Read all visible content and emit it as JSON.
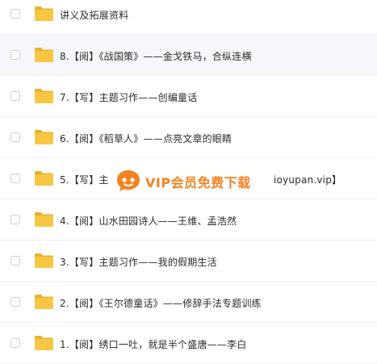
{
  "files": [
    {
      "name": "讲义及拓展资料"
    },
    {
      "name": "8.【阅】《战国策》——金戈铁马，合纵连横"
    },
    {
      "name": "7.【写】主题习作——创编童话"
    },
    {
      "name": "6.【阅】《稻草人》——点亮文章的眼睛"
    },
    {
      "name_prefix": "5.【写】主",
      "name_suffix": "ioyupan.vip】"
    },
    {
      "name": "4.【阅】山水田园诗人——王维、孟浩然"
    },
    {
      "name": "3.【写】主题习作——我的假期生活"
    },
    {
      "name": "2.【阅】《王尔德童话》——修辞手法专题训练"
    },
    {
      "name": "1.【阅】绣口一吐，就是半个盛唐——李白"
    }
  ],
  "watermark": {
    "text": "VIP会员免费下载",
    "color": "#f58220"
  },
  "colors": {
    "folder": "#f7c744",
    "folder_dark": "#eab12c",
    "hover_row": "#f5f7fa"
  }
}
